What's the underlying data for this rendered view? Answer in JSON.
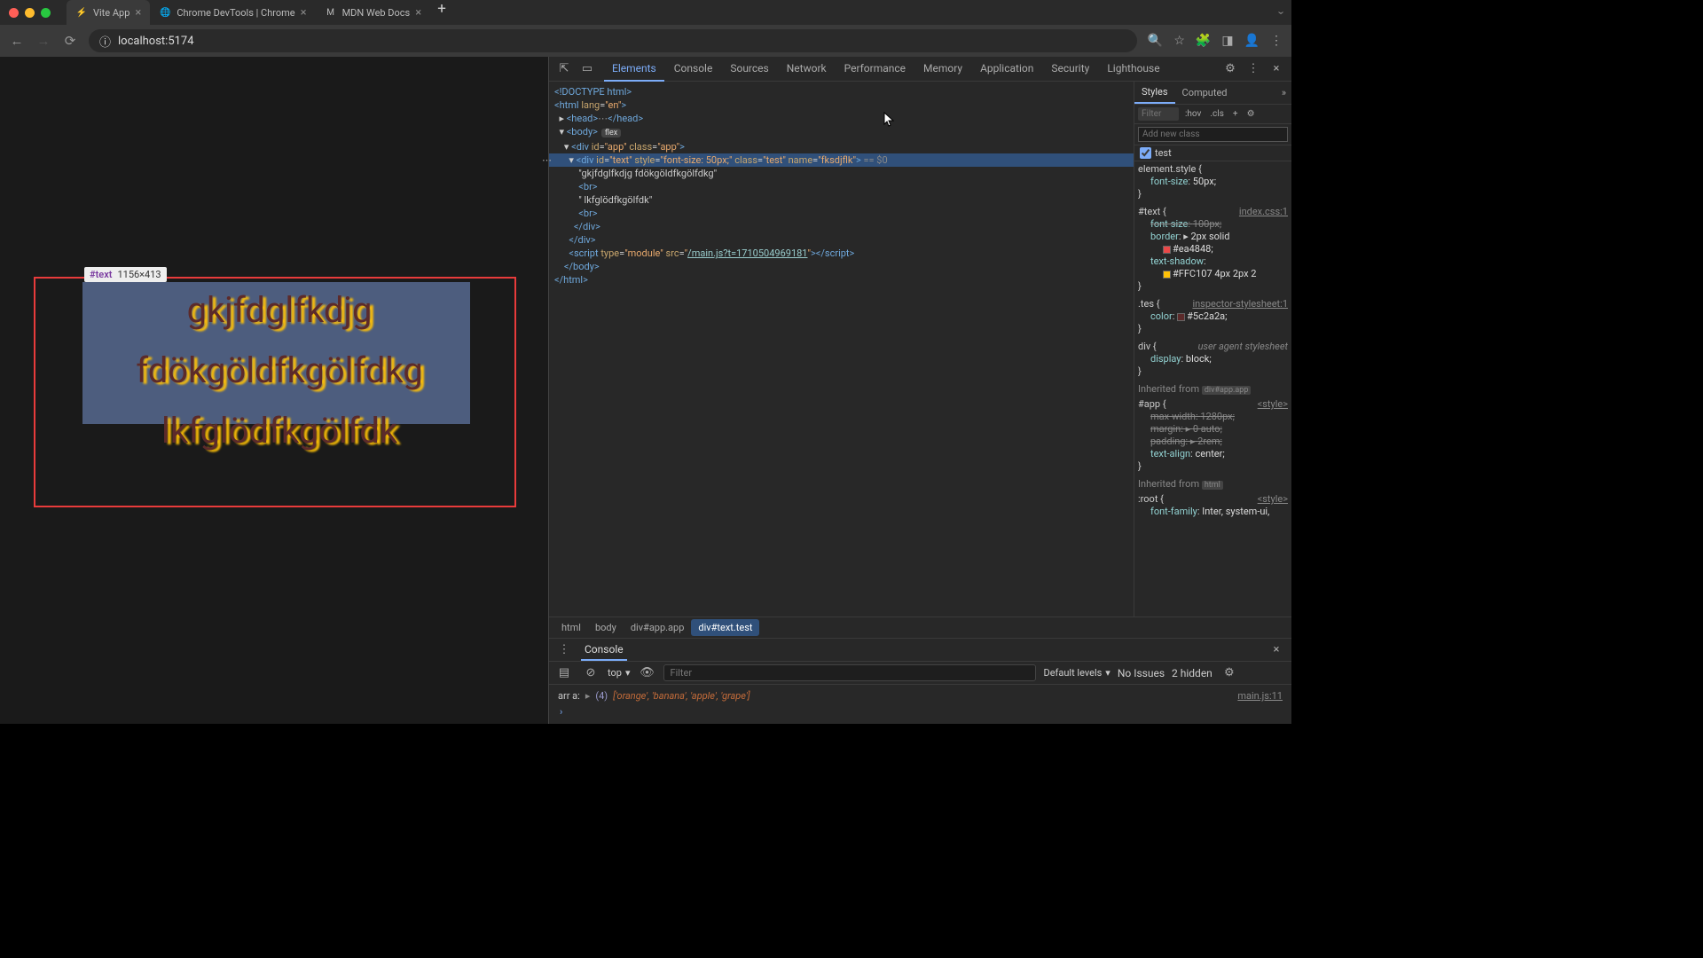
{
  "tabs": [
    {
      "title": "Vite App",
      "active": true
    },
    {
      "title": "Chrome DevTools | Chrome",
      "active": false
    },
    {
      "title": "MDN Web Docs",
      "active": false
    }
  ],
  "url": "localhost:5174",
  "inspect": {
    "selector": "#text",
    "dims": "1156×413"
  },
  "pageText": {
    "l1": "gkjfdglfkdjg",
    "l2": "fdökgöldfkgölfdkg",
    "l3": "lkfglödfkgölfdk"
  },
  "devtoolsTabs": [
    "Elements",
    "Console",
    "Sources",
    "Network",
    "Performance",
    "Memory",
    "Application",
    "Security",
    "Lighthouse"
  ],
  "activeDevTab": "Elements",
  "dom": {
    "doctype": "<!DOCTYPE html>",
    "htmlOpen": "<html lang=\"en\">",
    "head": "<head>…</head>",
    "bodyOpen": "<body>",
    "flexBadge": "flex",
    "appOpen": "<div id=\"app\" class=\"app\">",
    "textDiv": {
      "tag": "div",
      "id": "text",
      "style": "font-size: 50px;",
      "class": "test",
      "name": "fksdjflk",
      "suffix": " == $0"
    },
    "txt1": "\"gkjfdglfkdjg fdökgöldfkgölfdkg\"",
    "br": "<br>",
    "txt2": "\" lkfglödfkgölfdk\"",
    "divClose": "</div>",
    "script": {
      "type": "module",
      "src": "/main.js?t=1710504969181"
    },
    "bodyClose": "</body>",
    "htmlClose": "</html>"
  },
  "stylesTabs": [
    "Styles",
    "Computed"
  ],
  "filterPlaceholder": "Filter",
  "hov": ":hov",
  "cls": ".cls",
  "addClassPlaceholder": "Add new class",
  "classCheckbox": "test",
  "rules": {
    "elStyle": {
      "sel": "element.style {",
      "props": [
        {
          "n": "font-size",
          "v": "50px;"
        }
      ]
    },
    "textRule": {
      "sel": "#text {",
      "src": "index.css:1",
      "props": [
        {
          "n": "font-size",
          "v": "100px;",
          "strike": true
        },
        {
          "n": "border",
          "v": "2px solid",
          "swatch": "#ea4848",
          "extra": "#ea4848;"
        },
        {
          "n": "text-shadow",
          "swatch": "#FFC107",
          "v": "#FFC107 4px 2px 2"
        }
      ]
    },
    "tesRule": {
      "sel": ".tes {",
      "src": "inspector-stylesheet:1",
      "props": [
        {
          "n": "color",
          "swatch": "#5c2a2a",
          "v": "#5c2a2a;"
        }
      ]
    },
    "divRule": {
      "sel": "div {",
      "src": "user agent stylesheet",
      "props": [
        {
          "n": "display",
          "v": "block;"
        }
      ]
    },
    "inheritApp": "Inherited from",
    "inheritAppTag": "div#app.app",
    "appRule": {
      "sel": "#app {",
      "src": "<style>",
      "props": [
        {
          "n": "max-width",
          "v": "1280px;"
        },
        {
          "n": "margin",
          "v": "0 auto;"
        },
        {
          "n": "padding",
          "v": "2rem;"
        },
        {
          "n": "text-align",
          "v": "center;"
        }
      ]
    },
    "inheritHtml": "Inherited from",
    "inheritHtmlTag": "html",
    "rootRule": {
      "sel": ":root {",
      "src": "<style>",
      "props": [
        {
          "n": "font-family",
          "v": "Inter, system-ui,"
        }
      ]
    }
  },
  "breadcrumbs": [
    "html",
    "body",
    "div#app.app",
    "div#text.test"
  ],
  "console": {
    "tabLabel": "Console",
    "context": "top",
    "levels": "Default levels",
    "issues": "No Issues",
    "hidden": "2 hidden",
    "filterPlaceholder": "Filter",
    "log": {
      "label": "arr a:",
      "expand": "(4)",
      "array": "['orange', 'banana', 'apple', 'grape']",
      "src": "main.js:11"
    }
  }
}
